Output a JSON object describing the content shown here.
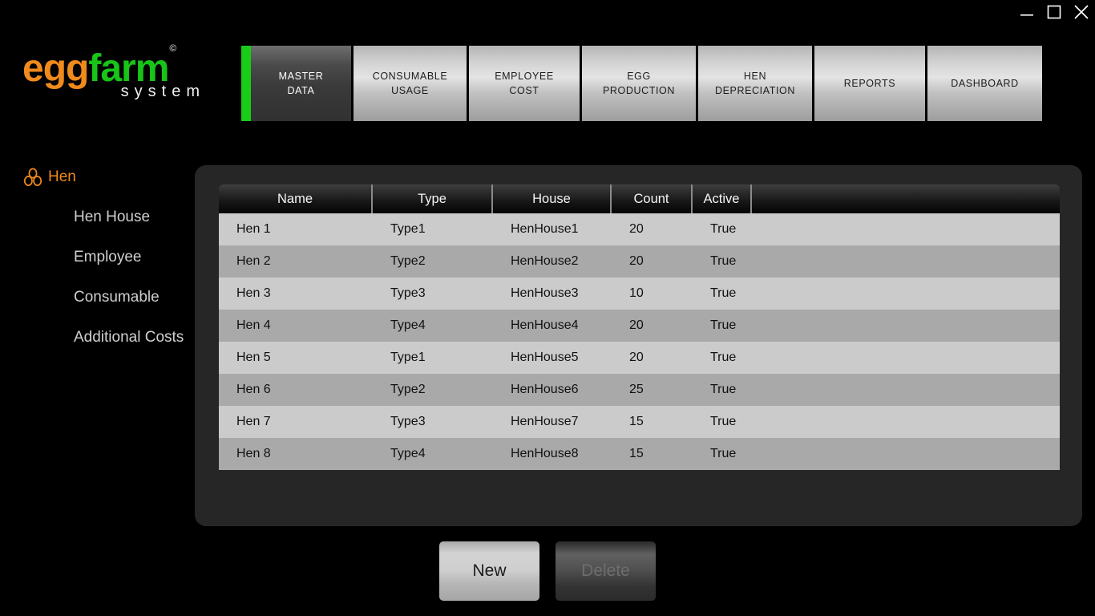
{
  "window": {
    "controls": [
      {
        "name": "minimize",
        "glyph": "minimize-icon"
      },
      {
        "name": "maximize",
        "glyph": "maximize-icon"
      },
      {
        "name": "close",
        "glyph": "close-icon"
      }
    ]
  },
  "brand": {
    "part1": "egg",
    "part2": "farm",
    "copyright": "©",
    "subtitle": "system",
    "colors": {
      "egg": "#f08a1c",
      "farm": "#18c418",
      "system": "#f2f2f2"
    }
  },
  "tabs": {
    "active_index": 0,
    "accent": "#18cc18",
    "items": [
      {
        "label": "MASTER\nDATA",
        "line1": "MASTER",
        "line2": "DATA"
      },
      {
        "label": "CONSUMABLE USAGE",
        "line1": "CONSUMABLE",
        "line2": "USAGE"
      },
      {
        "label": "EMPLOYEE COST",
        "line1": "EMPLOYEE",
        "line2": "COST"
      },
      {
        "label": "EGG PRODUCTION",
        "line1": "EGG",
        "line2": "PRODUCTION"
      },
      {
        "label": "HEN DEPRECIATION",
        "line1": "HEN",
        "line2": "DEPRECIATION"
      },
      {
        "label": "REPORTS",
        "line1": "REPORTS",
        "line2": ""
      },
      {
        "label": "DASHBOARD",
        "line1": "DASHBOARD",
        "line2": ""
      }
    ]
  },
  "sidebar": {
    "active_index": 0,
    "active_color": "#f08a1c",
    "items": [
      {
        "label": "Hen",
        "icon": "eggs-cluster-icon"
      },
      {
        "label": "Hen House",
        "icon": ""
      },
      {
        "label": "Employee",
        "icon": ""
      },
      {
        "label": "Consumable",
        "icon": ""
      },
      {
        "label": "Additional Costs",
        "icon": ""
      }
    ]
  },
  "table": {
    "columns": [
      "Name",
      "Type",
      "House",
      "Count",
      "Active"
    ],
    "rows": [
      {
        "name": "Hen 1",
        "type": "Type1",
        "house": "HenHouse1",
        "count": "20",
        "active": "True"
      },
      {
        "name": "Hen 2",
        "type": "Type2",
        "house": "HenHouse2",
        "count": "20",
        "active": "True"
      },
      {
        "name": "Hen 3",
        "type": "Type3",
        "house": "HenHouse3",
        "count": "10",
        "active": "True"
      },
      {
        "name": "Hen 4",
        "type": "Type4",
        "house": "HenHouse4",
        "count": "20",
        "active": "True"
      },
      {
        "name": "Hen 5",
        "type": "Type1",
        "house": "HenHouse5",
        "count": "20",
        "active": "True"
      },
      {
        "name": "Hen 6",
        "type": "Type2",
        "house": "HenHouse6",
        "count": "25",
        "active": "True"
      },
      {
        "name": "Hen 7",
        "type": "Type3",
        "house": "HenHouse7",
        "count": "15",
        "active": "True"
      },
      {
        "name": "Hen 8",
        "type": "Type4",
        "house": "HenHouse8",
        "count": "15",
        "active": "True"
      }
    ]
  },
  "actions": {
    "new_label": "New",
    "delete_label": "Delete",
    "delete_enabled": false
  }
}
